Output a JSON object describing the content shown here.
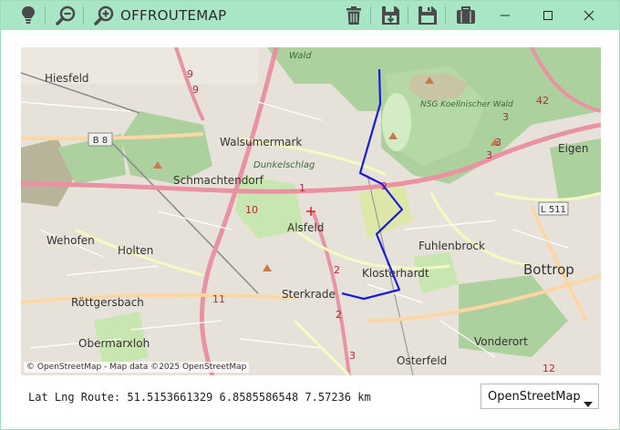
{
  "window": {
    "title": "OFFROUTEMAP",
    "controls": {
      "minimize": "–",
      "maximize": "□",
      "close": "✕"
    }
  },
  "toolbar": {
    "left_icons": [
      "lightbulb-icon",
      "zoom-out-icon",
      "zoom-in-icon"
    ],
    "right_icons": [
      "trash-icon",
      "save-download-icon",
      "save-icon",
      "briefcase-icon"
    ]
  },
  "map": {
    "attribution": "© OpenStreetMap - Map data ©2025 OpenStreetMap",
    "places": [
      {
        "name": "Hiesfeld"
      },
      {
        "name": "Walsumermark"
      },
      {
        "name": "Schmachtendorf"
      },
      {
        "name": "Dunkelschlag"
      },
      {
        "name": "Alsfeld"
      },
      {
        "name": "Wehofen"
      },
      {
        "name": "Holten"
      },
      {
        "name": "Röttgersbach"
      },
      {
        "name": "Obermarxloh"
      },
      {
        "name": "Sterkrade"
      },
      {
        "name": "Klosterhardt"
      },
      {
        "name": "Fuhlenbrock"
      },
      {
        "name": "Bottrop"
      },
      {
        "name": "Eigen"
      },
      {
        "name": "Vonderort"
      },
      {
        "name": "Osterfeld"
      },
      {
        "name": "Wald"
      },
      {
        "name": "NSG Koellnischer Wald"
      }
    ],
    "road_labels": [
      "B 8",
      "L 511",
      "9",
      "10",
      "11",
      "42",
      "2",
      "3",
      "1",
      "12"
    ],
    "colors": {
      "route": "#1a1adc",
      "forest": "#add19e",
      "motorway": "#e892a2",
      "primary": "#fcd6a4",
      "secondary": "#f7fabf",
      "urban": "#e0dcd4",
      "marker": "#e02020"
    }
  },
  "status": {
    "text": "Lat Lng Route: 51.5153661329 6.8585586548 7.57236 km"
  },
  "tile_source": {
    "selected": "OpenStreetMap"
  }
}
